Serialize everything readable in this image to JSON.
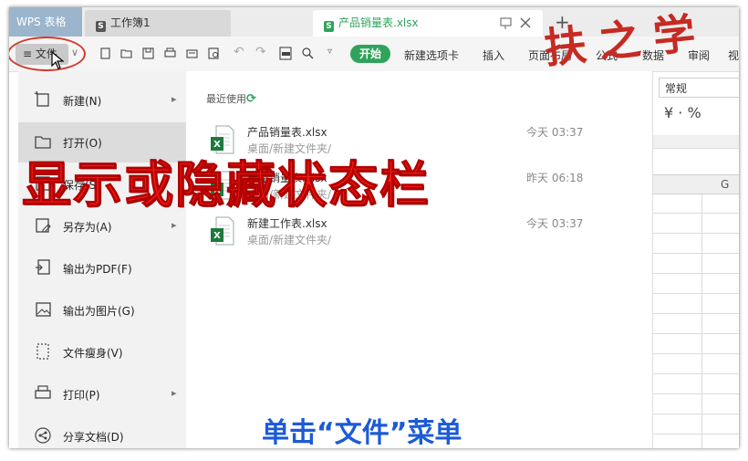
{
  "titlebar": {
    "app_tab": "WPS 表格",
    "tabs": [
      {
        "label": "工作簿1"
      },
      {
        "label": "产品销量表.xlsx"
      }
    ]
  },
  "toolbar": {
    "file_label": "文件",
    "ribbon_tabs": [
      "开始",
      "新建选项卡",
      "插入",
      "页面布局",
      "公式",
      "数据",
      "审阅",
      "视"
    ]
  },
  "file_menu": {
    "items": [
      {
        "label": "新建(N)",
        "icon": "new-icon",
        "has_submenu": true
      },
      {
        "label": "打开(O)",
        "icon": "folder-open-icon",
        "has_submenu": false
      },
      {
        "label": "保存(S)",
        "icon": "save-icon",
        "has_submenu": false
      },
      {
        "label": "另存为(A)",
        "icon": "save-as-icon",
        "has_submenu": true
      },
      {
        "label": "输出为PDF(F)",
        "icon": "pdf-export-icon",
        "has_submenu": false
      },
      {
        "label": "输出为图片(G)",
        "icon": "image-export-icon",
        "has_submenu": false
      },
      {
        "label": "文件瘦身(V)",
        "icon": "file-slim-icon",
        "has_submenu": false
      },
      {
        "label": "打印(P)",
        "icon": "print-icon",
        "has_submenu": true
      },
      {
        "label": "分享文档(D)",
        "icon": "share-icon",
        "has_submenu": false
      }
    ],
    "recent_title": "最近使用",
    "recent": [
      {
        "name": "产品销量表.xlsx",
        "path": "桌面/新建文件夹/",
        "time": "今天 03:37"
      },
      {
        "name": "产品销量表.xlsx",
        "path": "桌面/新建文件夹/",
        "time": "昨天 06:18"
      },
      {
        "name": "新建工作表.xlsx",
        "path": "桌面/新建文件夹/",
        "time": "今天 03:37"
      }
    ]
  },
  "sheet": {
    "number_format": "常规",
    "format_symbols": "¥ · %",
    "col_g": "G"
  },
  "overlay": {
    "brush_text": "扶之学",
    "caption_red": "显示或隐藏状态栏",
    "caption_blue": "单击“文件”菜单"
  },
  "colors": {
    "accent_green": "#2fa35b",
    "caption_red": "#f21a14",
    "caption_blue": "#1c5bd6",
    "ring_red": "#d23a2e"
  }
}
